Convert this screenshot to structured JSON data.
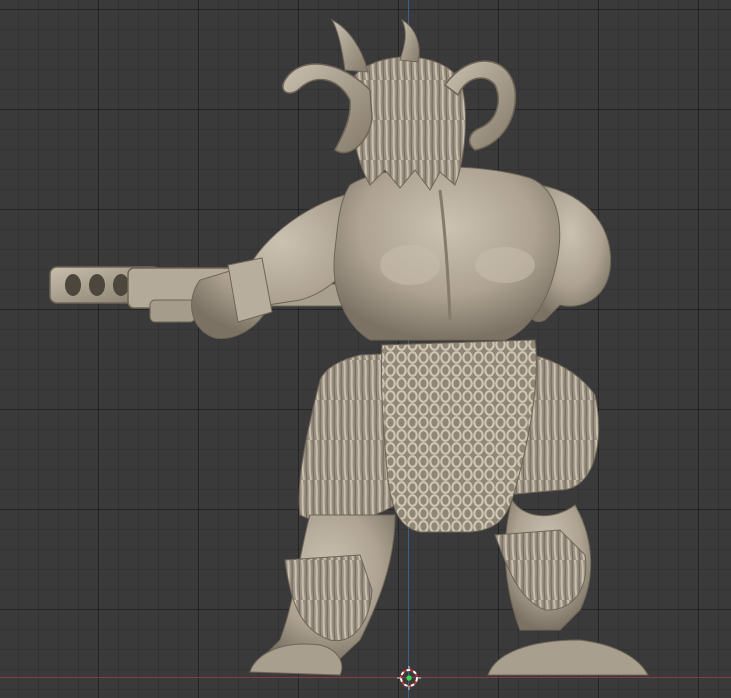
{
  "viewport": {
    "background_color": "#393939",
    "grid_color": "#2f2f2f",
    "axis_colors": {
      "x": "#8a3a45",
      "z": "#3f5f8f"
    },
    "model_color": "#b2a898",
    "icons": [
      "3d-cursor-icon"
    ]
  }
}
